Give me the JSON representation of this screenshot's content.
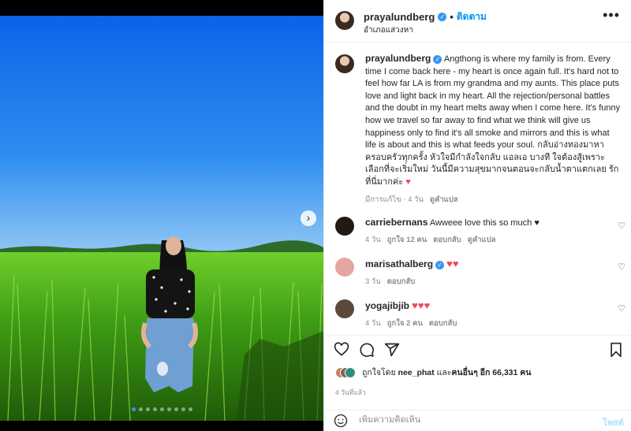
{
  "header": {
    "username": "prayalundberg",
    "follow_label": "ติดตาม",
    "location": "อำเภอแสวงหา",
    "more_icon": "more-horizontal-icon"
  },
  "caption": {
    "username": "prayalundberg",
    "text": "Angthong is where my family is from. Every time I come back here - my heart is once again full. It's hard not to feel how far LA is from my grandma and my aunts. This place puts love and light back in my heart. All the rejection/personal battles and the doubt in my heart melts away when I come here. It's funny how we travel so far away to find what we think will give us happiness only to find it's all smoke and mirrors and this is what life is about and this is what feeds your soul. กลับอ่างทองมาหาครอบครัวทุกครั้ง หัวใจมีกำลังใจกลับ แอลเอ บางที ใจต้องสู้เพราะเลือกที่จะเริ่มใหม่ วันนี้มีความสุขมากจนตอนจะกลับน้ำตาแตกเลย รักที่นี่มากค่ะ",
    "heart": "♥",
    "edited": "มีการแก้ไข",
    "time": "4 วัน",
    "translate": "ดูคำแปล"
  },
  "comments": [
    {
      "username": "carriebernans",
      "text": "Awweee love this so much ♥",
      "time": "4 วัน",
      "likes": "ถูกใจ 12 คน",
      "reply": "ตอบกลับ",
      "translate": "ดูคำแปล",
      "verified": false
    },
    {
      "username": "marisathalberg",
      "text": "♥♥",
      "time": "3 วัน",
      "reply": "ตอบกลับ",
      "verified": true
    },
    {
      "username": "yogajibjib",
      "text": "♥♥♥",
      "time": "4 วัน",
      "likes": "ถูกใจ 2 คน",
      "reply": "ตอบกลับ",
      "verified": false
    }
  ],
  "likes": {
    "prefix": "ถูกใจโดย",
    "user": "nee_phat",
    "middle": "และ",
    "others": "คนอื่นๆ อีก 66,331 คน"
  },
  "post_time": "4 วันที่แล้ว",
  "comment_box": {
    "placeholder": "เพิ่มความคิดเห็น",
    "post_label": "โพสต์"
  },
  "carousel": {
    "dot_count": 9,
    "active_index": 0
  },
  "colors": {
    "accent": "#0095f6",
    "verified": "#3897f0",
    "heart": "#ed4956"
  }
}
